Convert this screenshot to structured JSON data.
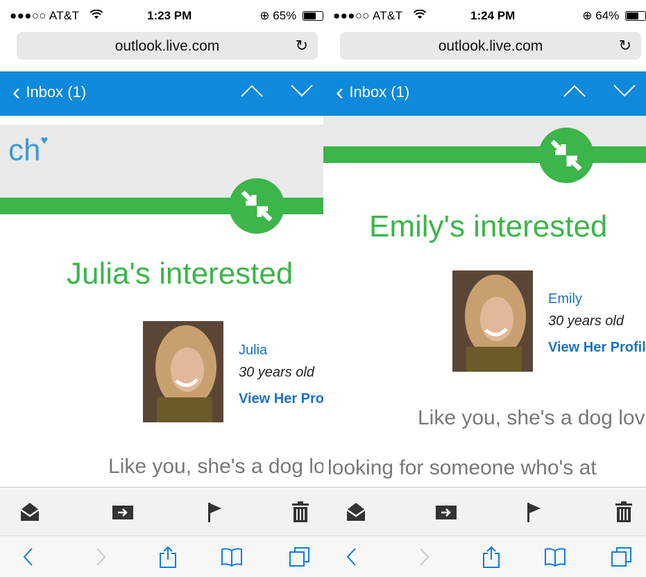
{
  "left": {
    "status": {
      "carrier": "●●●○○ AT&T",
      "time": "1:23 PM",
      "battery": "65%",
      "battery_level": 0.65
    },
    "address": "outlook.live.com",
    "nav": {
      "back_label": "Inbox (1)"
    },
    "logo_fragment": "ch",
    "headline": "Julia's interested",
    "profile": {
      "name": "Julia",
      "age": "30 years old",
      "link": "View Her Profile"
    },
    "body": "Like you, she's a dog lover"
  },
  "right": {
    "status": {
      "carrier": "●●●○○ AT&T",
      "time": "1:24 PM",
      "battery": "64%",
      "battery_level": 0.64
    },
    "address": "outlook.live.com",
    "nav": {
      "back_label": "Inbox (1)"
    },
    "headline": "Emily's interested",
    "profile": {
      "name": "Emily",
      "age": "30 years old",
      "link": "View Her Profile"
    },
    "body": "Like you, she's a dog lover",
    "body2": "looking for someone who's at"
  },
  "icons": {
    "reload": "reload-icon",
    "mail_open": "mail-open-icon",
    "move": "move-folder-icon",
    "flag": "flag-icon",
    "trash": "trash-icon",
    "back": "back-icon",
    "forward": "forward-icon",
    "share": "share-icon",
    "bookmarks": "bookmarks-icon",
    "tabs": "tabs-icon"
  },
  "colors": {
    "nav_blue": "#0f89db",
    "match_green": "#3cb54a",
    "link_blue": "#1a73c7"
  }
}
